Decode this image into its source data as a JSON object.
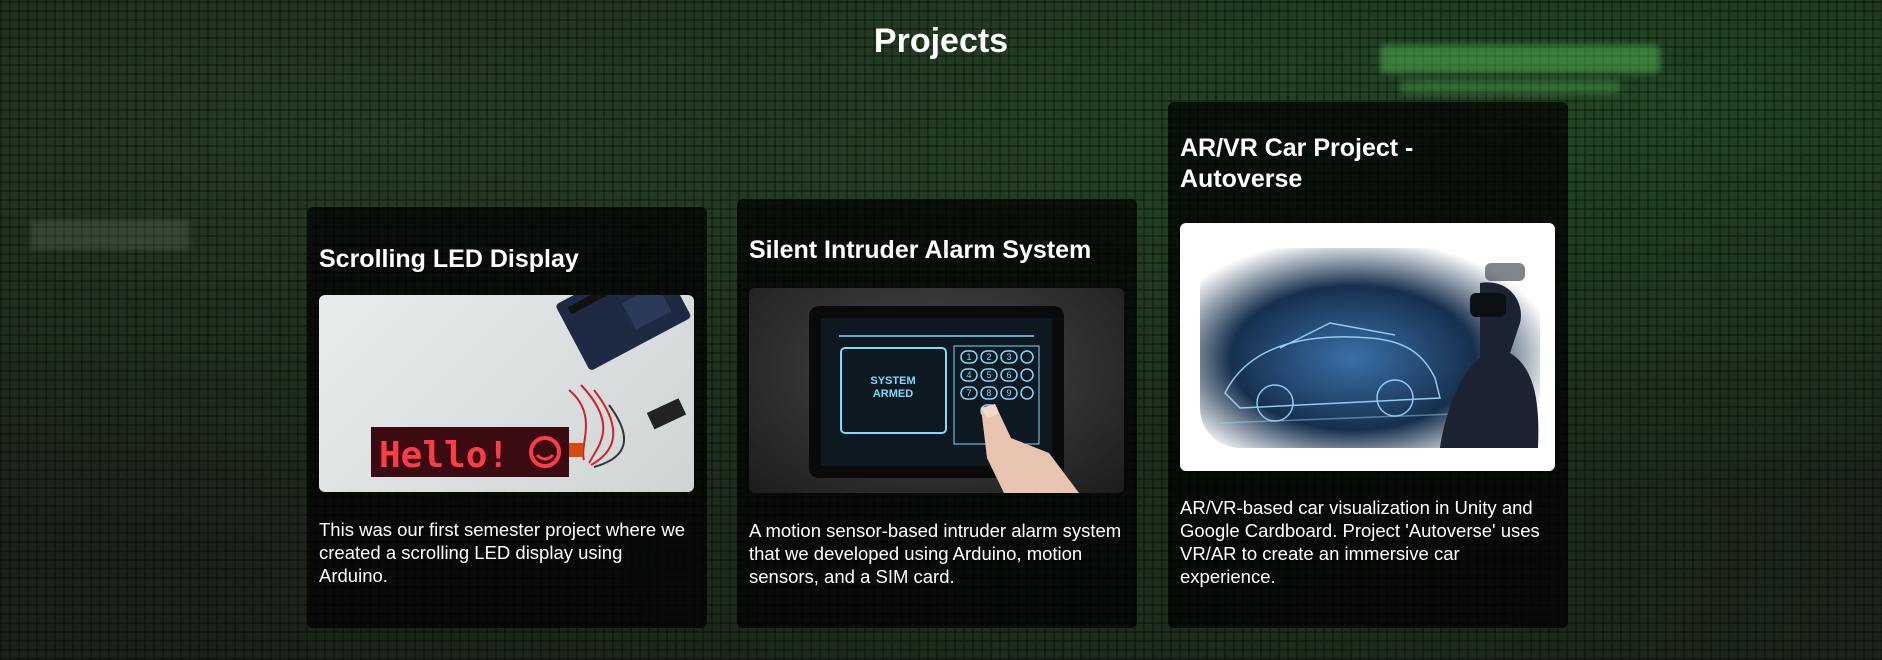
{
  "page": {
    "title": "Projects"
  },
  "projects": [
    {
      "title": "Scrolling LED Display",
      "image_text": "Hello!",
      "description": "This was our first semester project where we created a scrolling LED display using Arduino."
    },
    {
      "title": "Silent Intruder Alarm System",
      "image_text": "SYSTEM ARMED",
      "keypad_keys": [
        "1",
        "2",
        "3",
        "4",
        "5",
        "6",
        "7",
        "8",
        "9"
      ],
      "description": "A motion sensor-based intruder alarm system that we developed using Arduino, motion sensors, and a SIM card."
    },
    {
      "title": "AR/VR Car Project - Autoverse",
      "description": "AR/VR-based car visualization in Unity and Google Cardboard. Project 'Autoverse' uses VR/AR to create an immersive car experience."
    }
  ],
  "colors": {
    "card_bg": "#000000",
    "led_red": "#ff3b4a",
    "hud_cyan": "#7fd8ff"
  }
}
